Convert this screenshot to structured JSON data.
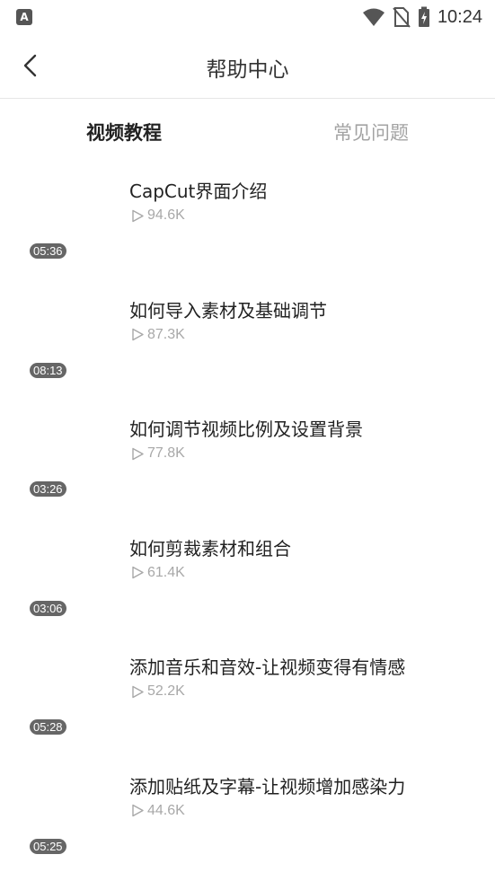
{
  "status_bar": {
    "time": "10:24",
    "icons": [
      "app-notification-icon",
      "wifi-icon",
      "no-sim-icon",
      "battery-charging-icon"
    ]
  },
  "header": {
    "title": "帮助中心",
    "back_icon": "chevron-left-icon"
  },
  "tabs": [
    {
      "label": "视频教程",
      "active": true
    },
    {
      "label": "常见问题",
      "active": false
    }
  ],
  "videos": [
    {
      "title": "CapCut界面介绍",
      "views": "94.6K",
      "duration": "05:36"
    },
    {
      "title": "如何导入素材及基础调节",
      "views": "87.3K",
      "duration": "08:13"
    },
    {
      "title": "如何调节视频比例及设置背景",
      "views": "77.8K",
      "duration": "03:26"
    },
    {
      "title": "如何剪裁素材和组合",
      "views": "61.4K",
      "duration": "03:06"
    },
    {
      "title": "添加音乐和音效-让视频变得有情感",
      "views": "52.2K",
      "duration": "05:28"
    },
    {
      "title": "添加贴纸及字幕-让视频增加感染力",
      "views": "44.6K",
      "duration": "05:25"
    }
  ],
  "colors": {
    "active_tab": "#222222",
    "inactive_tab": "#a3a3a3",
    "views_text": "#a8a8a8",
    "duration_badge": "#666666",
    "divider": "#e6e6e6"
  }
}
